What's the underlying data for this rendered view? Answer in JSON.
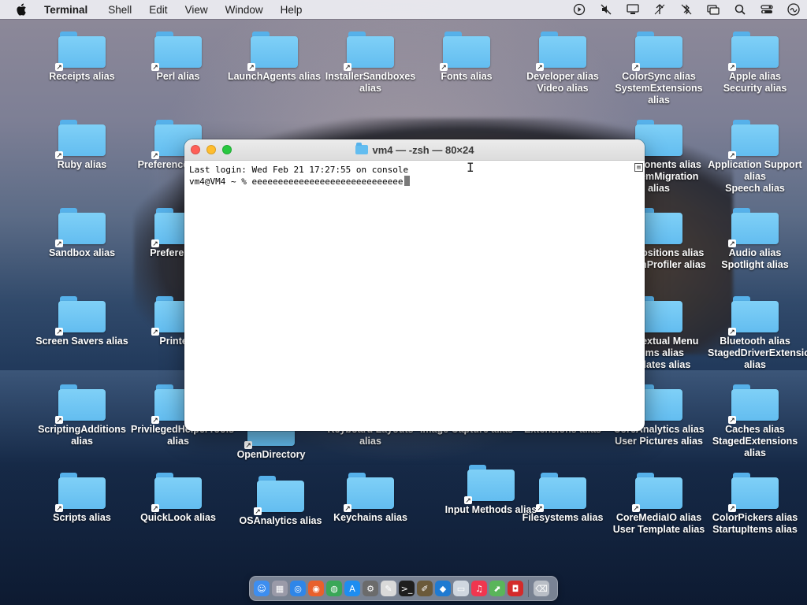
{
  "menubar": {
    "app": "Terminal",
    "items": [
      "Shell",
      "Edit",
      "View",
      "Window",
      "Help"
    ],
    "status_icons": [
      "play-circle-icon",
      "mute-icon",
      "display-icon",
      "network-icon",
      "bluetooth-off-icon",
      "screen-mirror-icon",
      "search-icon",
      "control-center-icon",
      "siri-icon"
    ]
  },
  "desktop": {
    "icons": [
      {
        "label": "Receipts alias"
      },
      {
        "label": "Perl alias"
      },
      {
        "label": "LaunchAgents alias"
      },
      {
        "label": "InstallerSandboxes alias"
      },
      {
        "label": "Fonts alias"
      },
      {
        "label": "Developer alias\nVideo alias"
      },
      {
        "label": "ColorSync alias\nSystemExtensions alias"
      },
      {
        "label": "Apple alias\nSecurity alias"
      },
      {
        "label": "Ruby alias"
      },
      {
        "label": "Preferences alias"
      },
      {
        "label": "Components alias\nSystemMigration alias"
      },
      {
        "label": "Application Support alias\nSpeech alias"
      },
      {
        "label": "Sandbox alias"
      },
      {
        "label": "Preferences"
      },
      {
        "label": "Compositions alias\nSystemProfiler alias"
      },
      {
        "label": "Audio alias\nSpotlight alias"
      },
      {
        "label": "Screen Savers alias"
      },
      {
        "label": "Printers"
      },
      {
        "label": "Contextual Menu Items alias\nUpdates alias"
      },
      {
        "label": "Bluetooth alias\nStagedDriverExtensions alias"
      },
      {
        "label": "ScriptingAdditions alias"
      },
      {
        "label": "PrivilegedHelperTools alias"
      },
      {
        "label": "OpenDirectory"
      },
      {
        "label": "Keyboard Layouts alias"
      },
      {
        "label": "Image Capture alias"
      },
      {
        "label": "Extensions alias"
      },
      {
        "label": "CoreAnalytics alias\nUser Pictures alias"
      },
      {
        "label": "Caches alias\nStagedExtensions alias"
      },
      {
        "label": "Scripts alias"
      },
      {
        "label": "QuickLook alias"
      },
      {
        "label": "OSAnalytics alias"
      },
      {
        "label": "Keychains alias"
      },
      {
        "label": "Input Methods alias"
      },
      {
        "label": "Filesystems alias"
      },
      {
        "label": "CoreMediaIO alias\nUser Template alias"
      },
      {
        "label": "ColorPickers alias\nStartupItems alias"
      }
    ]
  },
  "terminal": {
    "title": "vm4 — -zsh — 80×24",
    "line1": "Last login: Wed Feb 21 17:27:55 on console",
    "prompt": "vm4@VM4 ~ % ",
    "input": "eeeeeeeeeeeeeeeeeeeeeeeeeeeee"
  },
  "dock": {
    "apps": [
      {
        "name": "finder-icon",
        "glyph": "☺",
        "color": "#3d8ef0"
      },
      {
        "name": "launchpad-icon",
        "glyph": "▦",
        "color": "#9a9aa8"
      },
      {
        "name": "safari-icon",
        "glyph": "◎",
        "color": "#2f86e8"
      },
      {
        "name": "firefox-icon",
        "glyph": "◉",
        "color": "#e8602c"
      },
      {
        "name": "chrome-icon",
        "glyph": "◍",
        "color": "#3aa757"
      },
      {
        "name": "app-store-icon",
        "glyph": "A",
        "color": "#1e8df0"
      },
      {
        "name": "system-settings-icon",
        "glyph": "⚙",
        "color": "#6b6b6b"
      },
      {
        "name": "textedit-icon",
        "glyph": "✎",
        "color": "#d9d9d9"
      },
      {
        "name": "terminal-icon",
        "glyph": ">_",
        "color": "#1e1e1e"
      },
      {
        "name": "script-editor-icon",
        "glyph": "✐",
        "color": "#6b5a3a"
      },
      {
        "name": "vscode-icon",
        "glyph": "◆",
        "color": "#1f7ad1"
      },
      {
        "name": "preview-icon",
        "glyph": "▭",
        "color": "#cfd6df"
      },
      {
        "name": "music-icon",
        "glyph": "♫",
        "color": "#f0364f"
      },
      {
        "name": "maps-icon",
        "glyph": "⬈",
        "color": "#5ab55a"
      },
      {
        "name": "photo-booth-icon",
        "glyph": "◘",
        "color": "#d42a2a"
      },
      {
        "name": "trash-icon",
        "glyph": "⌫",
        "color": "#b9bec6"
      }
    ]
  }
}
